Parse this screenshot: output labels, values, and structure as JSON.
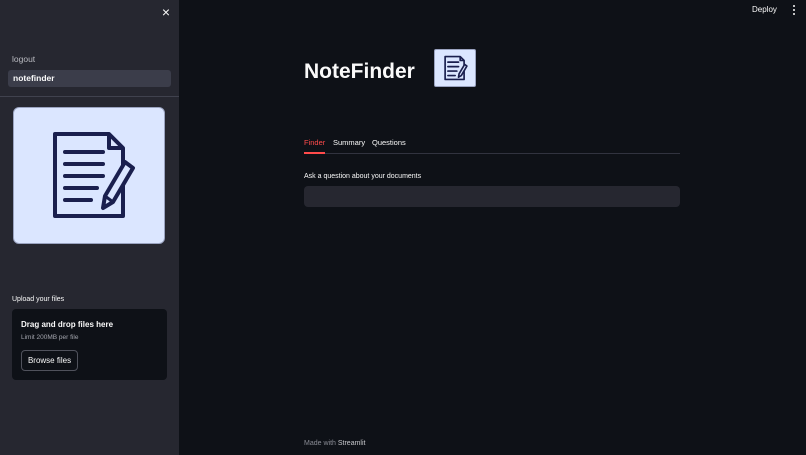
{
  "sidebar": {
    "close_icon": "×",
    "nav": [
      {
        "label": "logout"
      },
      {
        "label": "notefinder"
      }
    ],
    "image_icon": "document-pencil-icon",
    "upload": {
      "label": "Upload your files",
      "title": "Drag and drop files here",
      "limit": "Limit 200MB per file",
      "button": "Browse files"
    }
  },
  "header": {
    "deploy": "Deploy",
    "menu_icon": "more-vertical-icon"
  },
  "main": {
    "title": "NoteFinder",
    "title_icon": "document-pencil-icon",
    "tabs": [
      {
        "label": "Finder",
        "active": true
      },
      {
        "label": "Summary",
        "active": false
      },
      {
        "label": "Questions",
        "active": false
      }
    ],
    "question_label": "Ask a question about your documents",
    "question_value": ""
  },
  "footer": {
    "made_with": "Made with",
    "brand": "Streamlit"
  },
  "colors": {
    "background": "#0e1117",
    "sidebar": "#262730",
    "accent": "#ff4b4b",
    "image_bg": "#dbe6ff",
    "icon_stroke": "#1a1f4e"
  }
}
